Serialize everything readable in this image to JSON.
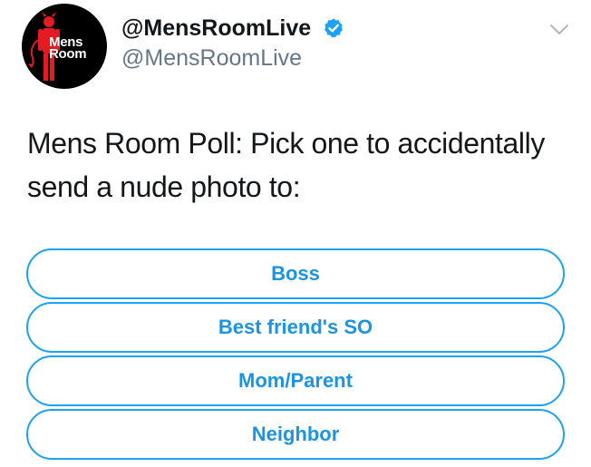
{
  "user": {
    "display_name": "@MensRoomLive",
    "handle": "@MensRoomLive",
    "verified": true,
    "avatar_logo": [
      "Mens",
      "Room"
    ]
  },
  "tweet": {
    "text": "Mens Room Poll: Pick one to accidentally send a nude photo to:"
  },
  "poll": {
    "options": [
      {
        "label": "Boss"
      },
      {
        "label": "Best friend's SO"
      },
      {
        "label": "Mom/Parent"
      },
      {
        "label": "Neighbor"
      }
    ]
  },
  "colors": {
    "accent": "#1da1f2",
    "option_text": "#1b95e0",
    "secondary_text": "#657786",
    "verified_badge": "#1da1f2",
    "logo_red": "#e31b23"
  },
  "icons": {
    "verified": "verified-badge-icon",
    "caret": "chevron-down-icon"
  }
}
